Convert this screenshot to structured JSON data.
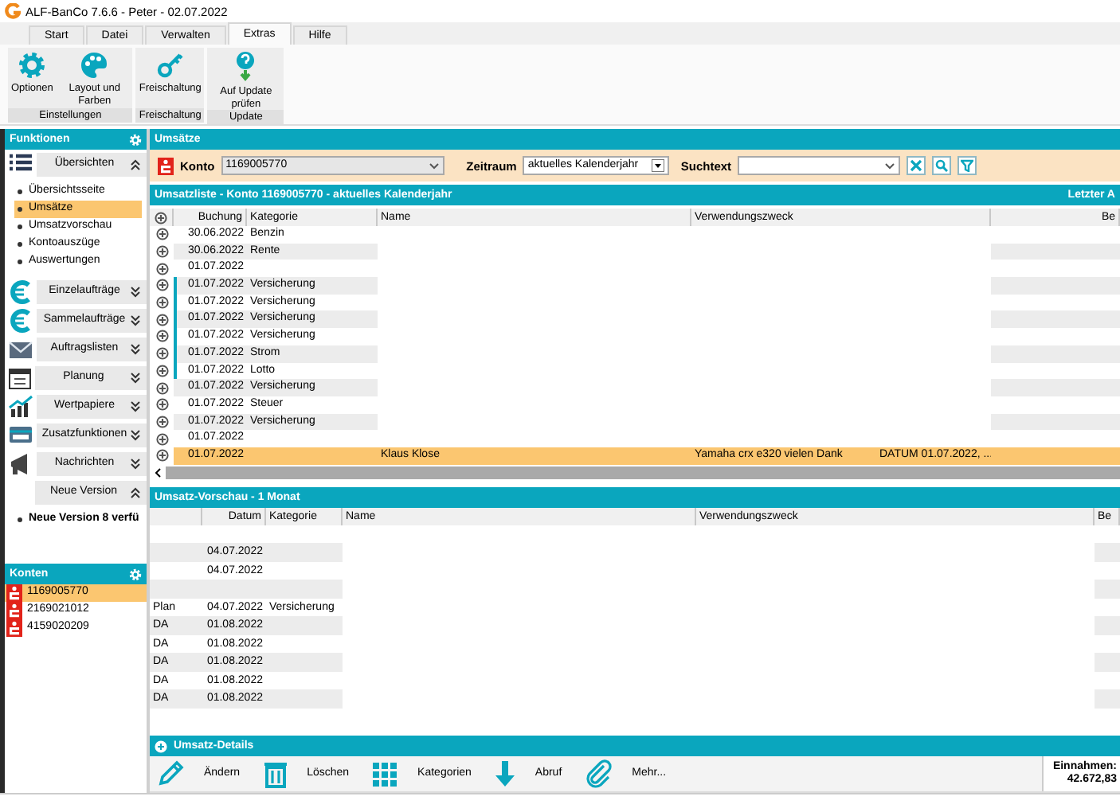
{
  "window": {
    "title": "ALF-BanCo 7.6.6 - Peter  -  02.07.2022"
  },
  "tabs": [
    {
      "label": "Start",
      "selected": false
    },
    {
      "label": "Datei",
      "selected": false
    },
    {
      "label": "Verwalten",
      "selected": false
    },
    {
      "label": "Extras",
      "selected": true
    },
    {
      "label": "Hilfe",
      "selected": false
    }
  ],
  "ribbon_groups": [
    {
      "label": "Einstellungen",
      "buttons": [
        {
          "label": "Optionen",
          "kind": "gear"
        },
        {
          "label": "Layout und Farben",
          "kind": "palette"
        }
      ]
    },
    {
      "label": "Freischaltung",
      "buttons": [
        {
          "label": "Freischaltung",
          "kind": "key"
        }
      ]
    },
    {
      "label": "Update",
      "buttons": [
        {
          "label": "Auf Update prüfen",
          "kind": "update"
        }
      ]
    }
  ],
  "sidebar": {
    "title": "Funktionen",
    "sections": [
      {
        "label": "Übersichten",
        "kind": "list",
        "expanded": true,
        "items": [
          {
            "label": "Übersichtsseite",
            "selected": false
          },
          {
            "label": "Umsätze",
            "selected": true
          },
          {
            "label": "Umsatzvorschau",
            "selected": false
          },
          {
            "label": "Kontoauszüge",
            "selected": false
          },
          {
            "label": "Auswertungen",
            "selected": false
          }
        ]
      },
      {
        "label": "Einzelaufträge",
        "kind": "euro",
        "expanded": false
      },
      {
        "label": "Sammelaufträge",
        "kind": "euro",
        "expanded": false
      },
      {
        "label": "Auftragslisten",
        "kind": "envelope",
        "expanded": false
      },
      {
        "label": "Planung",
        "kind": "calendar",
        "expanded": false
      },
      {
        "label": "Wertpapiere",
        "kind": "chart",
        "expanded": false
      },
      {
        "label": "Zusatzfunktionen",
        "kind": "card",
        "expanded": false
      },
      {
        "label": "Nachrichten",
        "kind": "megaphone",
        "expanded": false
      },
      {
        "label": "Neue Version",
        "kind": "news",
        "expanded": true,
        "items": [
          {
            "label": "Neue Version 8 verfü",
            "selected": false
          }
        ]
      }
    ]
  },
  "accounts": {
    "title": "Konten",
    "items": [
      {
        "number": "1169005770",
        "selected": true
      },
      {
        "number": "2169021012",
        "selected": false
      },
      {
        "number": "4159020209",
        "selected": false
      }
    ]
  },
  "main": {
    "title": "Umsätze",
    "konto_label": "Konto",
    "konto_value": "1169005770",
    "zeitraum_label": "Zeitraum",
    "zeitraum_value": "aktuelles Kalenderjahr",
    "suchtext_label": "Suchtext"
  },
  "transactions": {
    "title": "Umsatzliste - Konto 1169005770 - aktuelles Kalenderjahr",
    "title_right": "Letzter A",
    "columns": [
      "Buchung",
      "Kategorie",
      "Name",
      "Verwendungszweck",
      "Be"
    ],
    "rows": [
      {
        "date": "30.06.2022",
        "category": "Benzin",
        "marked": false,
        "selected": false
      },
      {
        "date": "30.06.2022",
        "category": "Rente",
        "marked": false,
        "selected": false
      },
      {
        "date": "01.07.2022",
        "marked": false,
        "selected": false
      },
      {
        "date": "01.07.2022",
        "category": "Versicherung",
        "marked": true,
        "selected": false
      },
      {
        "date": "01.07.2022",
        "category": "Versicherung",
        "marked": true,
        "selected": false
      },
      {
        "date": "01.07.2022",
        "category": "Versicherung",
        "marked": true,
        "selected": false
      },
      {
        "date": "01.07.2022",
        "category": "Versicherung",
        "marked": true,
        "selected": false
      },
      {
        "date": "01.07.2022",
        "category": "Strom",
        "marked": true,
        "selected": false
      },
      {
        "date": "01.07.2022",
        "category": "Lotto",
        "marked": true,
        "selected": false
      },
      {
        "date": "01.07.2022",
        "category": "Versicherung",
        "marked": false,
        "selected": false
      },
      {
        "date": "01.07.2022",
        "category": "Steuer",
        "marked": false,
        "selected": false
      },
      {
        "date": "01.07.2022",
        "category": "Versicherung",
        "marked": false,
        "selected": false
      },
      {
        "date": "01.07.2022",
        "marked": false,
        "selected": false
      },
      {
        "date": "01.07.2022",
        "name": "Klaus Klose",
        "purpose": "Yamaha crx e320 vielen Dank",
        "purpose_extra": "DATUM 01.07.2022, ...",
        "marked": false,
        "selected": true
      }
    ]
  },
  "preview": {
    "title": "Umsatz-Vorschau - 1 Monat",
    "columns": [
      "Datum",
      "Kategorie",
      "Name",
      "Verwendungszweck",
      "Be"
    ],
    "rows": [
      {},
      {
        "date": "04.07.2022"
      },
      {
        "date": "04.07.2022"
      },
      {},
      {
        "type": "Plan",
        "date": "04.07.2022",
        "category": "Versicherung"
      },
      {
        "type": "DA",
        "date": "01.08.2022"
      },
      {
        "type": "DA",
        "date": "01.08.2022"
      },
      {
        "type": "DA",
        "date": "01.08.2022"
      },
      {
        "type": "DA",
        "date": "01.08.2022"
      },
      {
        "type": "DA",
        "date": "01.08.2022"
      }
    ]
  },
  "details": {
    "title": "Umsatz-Details"
  },
  "toolbar": [
    {
      "label": "Ändern",
      "kind": "pencil"
    },
    {
      "label": "Löschen",
      "kind": "trash"
    },
    {
      "label": "Kategorien",
      "kind": "grid"
    },
    {
      "label": "Abruf",
      "kind": "download"
    },
    {
      "label": "Mehr...",
      "kind": "clip"
    }
  ],
  "summary": {
    "label": "Einnahmen:",
    "value": "42.672,83"
  }
}
